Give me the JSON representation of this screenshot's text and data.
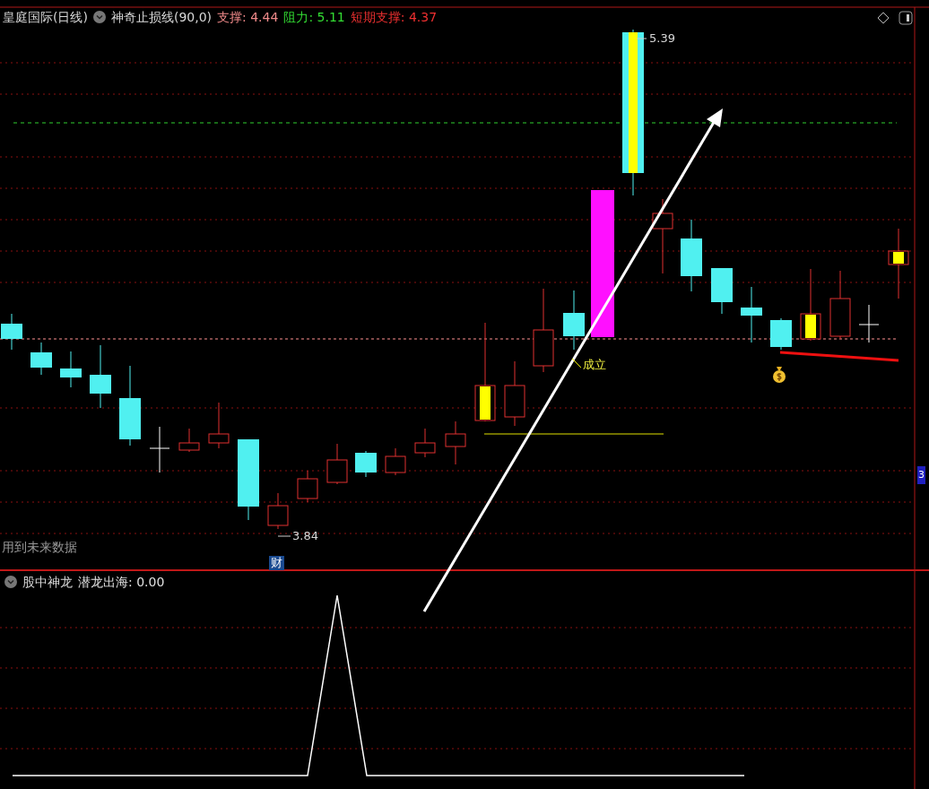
{
  "header": {
    "stock": "皇庭国际",
    "period": "(日线)",
    "indicator": "神奇止损线(90,0)",
    "readouts": [
      {
        "text": "支撑: 4.44",
        "color": "#f08a8a"
      },
      {
        "text": "阻力: 5.11",
        "color": "#33dd33"
      },
      {
        "text": "短期支撑: 4.37",
        "color": "#ee3030"
      }
    ]
  },
  "chart_labels": {
    "high": "5.39",
    "low": "3.84",
    "signal": "成立",
    "warning": "用到未来数据",
    "marker": "财",
    "side_tag": "3"
  },
  "sub_panel": {
    "title": "股中神龙",
    "readouts": [
      {
        "text": "潜龙出海: 0.00",
        "color": "#e0e0e0"
      }
    ]
  }
}
